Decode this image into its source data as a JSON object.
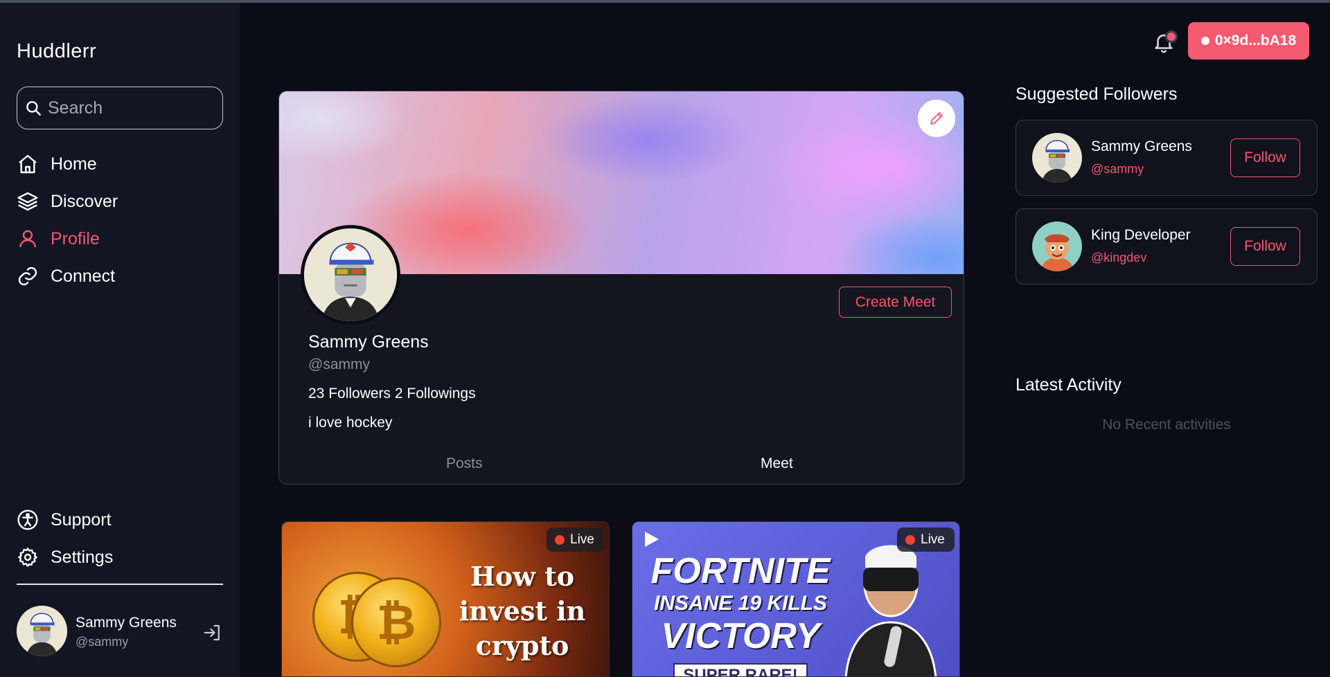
{
  "app": {
    "brand": "Huddlerr"
  },
  "search": {
    "placeholder": "Search"
  },
  "nav": {
    "items": [
      {
        "label": "Home",
        "icon": "home-icon",
        "active": false
      },
      {
        "label": "Discover",
        "icon": "layers-icon",
        "active": false
      },
      {
        "label": "Profile",
        "icon": "user-icon",
        "active": true
      },
      {
        "label": "Connect",
        "icon": "link-icon",
        "active": false
      }
    ],
    "bottom": [
      {
        "label": "Support",
        "icon": "accessibility-icon"
      },
      {
        "label": "Settings",
        "icon": "gear-icon"
      }
    ]
  },
  "current_user": {
    "name": "Sammy Greens",
    "handle": "@sammy"
  },
  "header": {
    "wallet": "0×9d...bA18"
  },
  "profile": {
    "name": "Sammy Greens",
    "handle": "@sammy",
    "stats": "23 Followers 2 Followings",
    "bio": "i love hockey",
    "create_meet": "Create Meet",
    "tabs": [
      "Posts",
      "Meet"
    ],
    "active_tab": "Meet"
  },
  "meets": [
    {
      "live": "Live",
      "title_lines": [
        "How to",
        "invest in",
        "crypto"
      ]
    },
    {
      "live": "Live",
      "title_lines": [
        "FORTNITE",
        "INSANE 19 KILLS",
        "VICTORY",
        "SUPER RARE!"
      ]
    }
  ],
  "suggested": {
    "title": "Suggested Followers",
    "items": [
      {
        "name": "Sammy Greens",
        "handle": "@sammy",
        "button": "Follow"
      },
      {
        "name": "King Developer",
        "handle": "@kingdev",
        "button": "Follow"
      }
    ]
  },
  "activity": {
    "title": "Latest Activity",
    "empty": "No Recent activities"
  },
  "colors": {
    "accent": "#f2596f",
    "background": "#0b0c16",
    "sidebar": "#141522"
  }
}
